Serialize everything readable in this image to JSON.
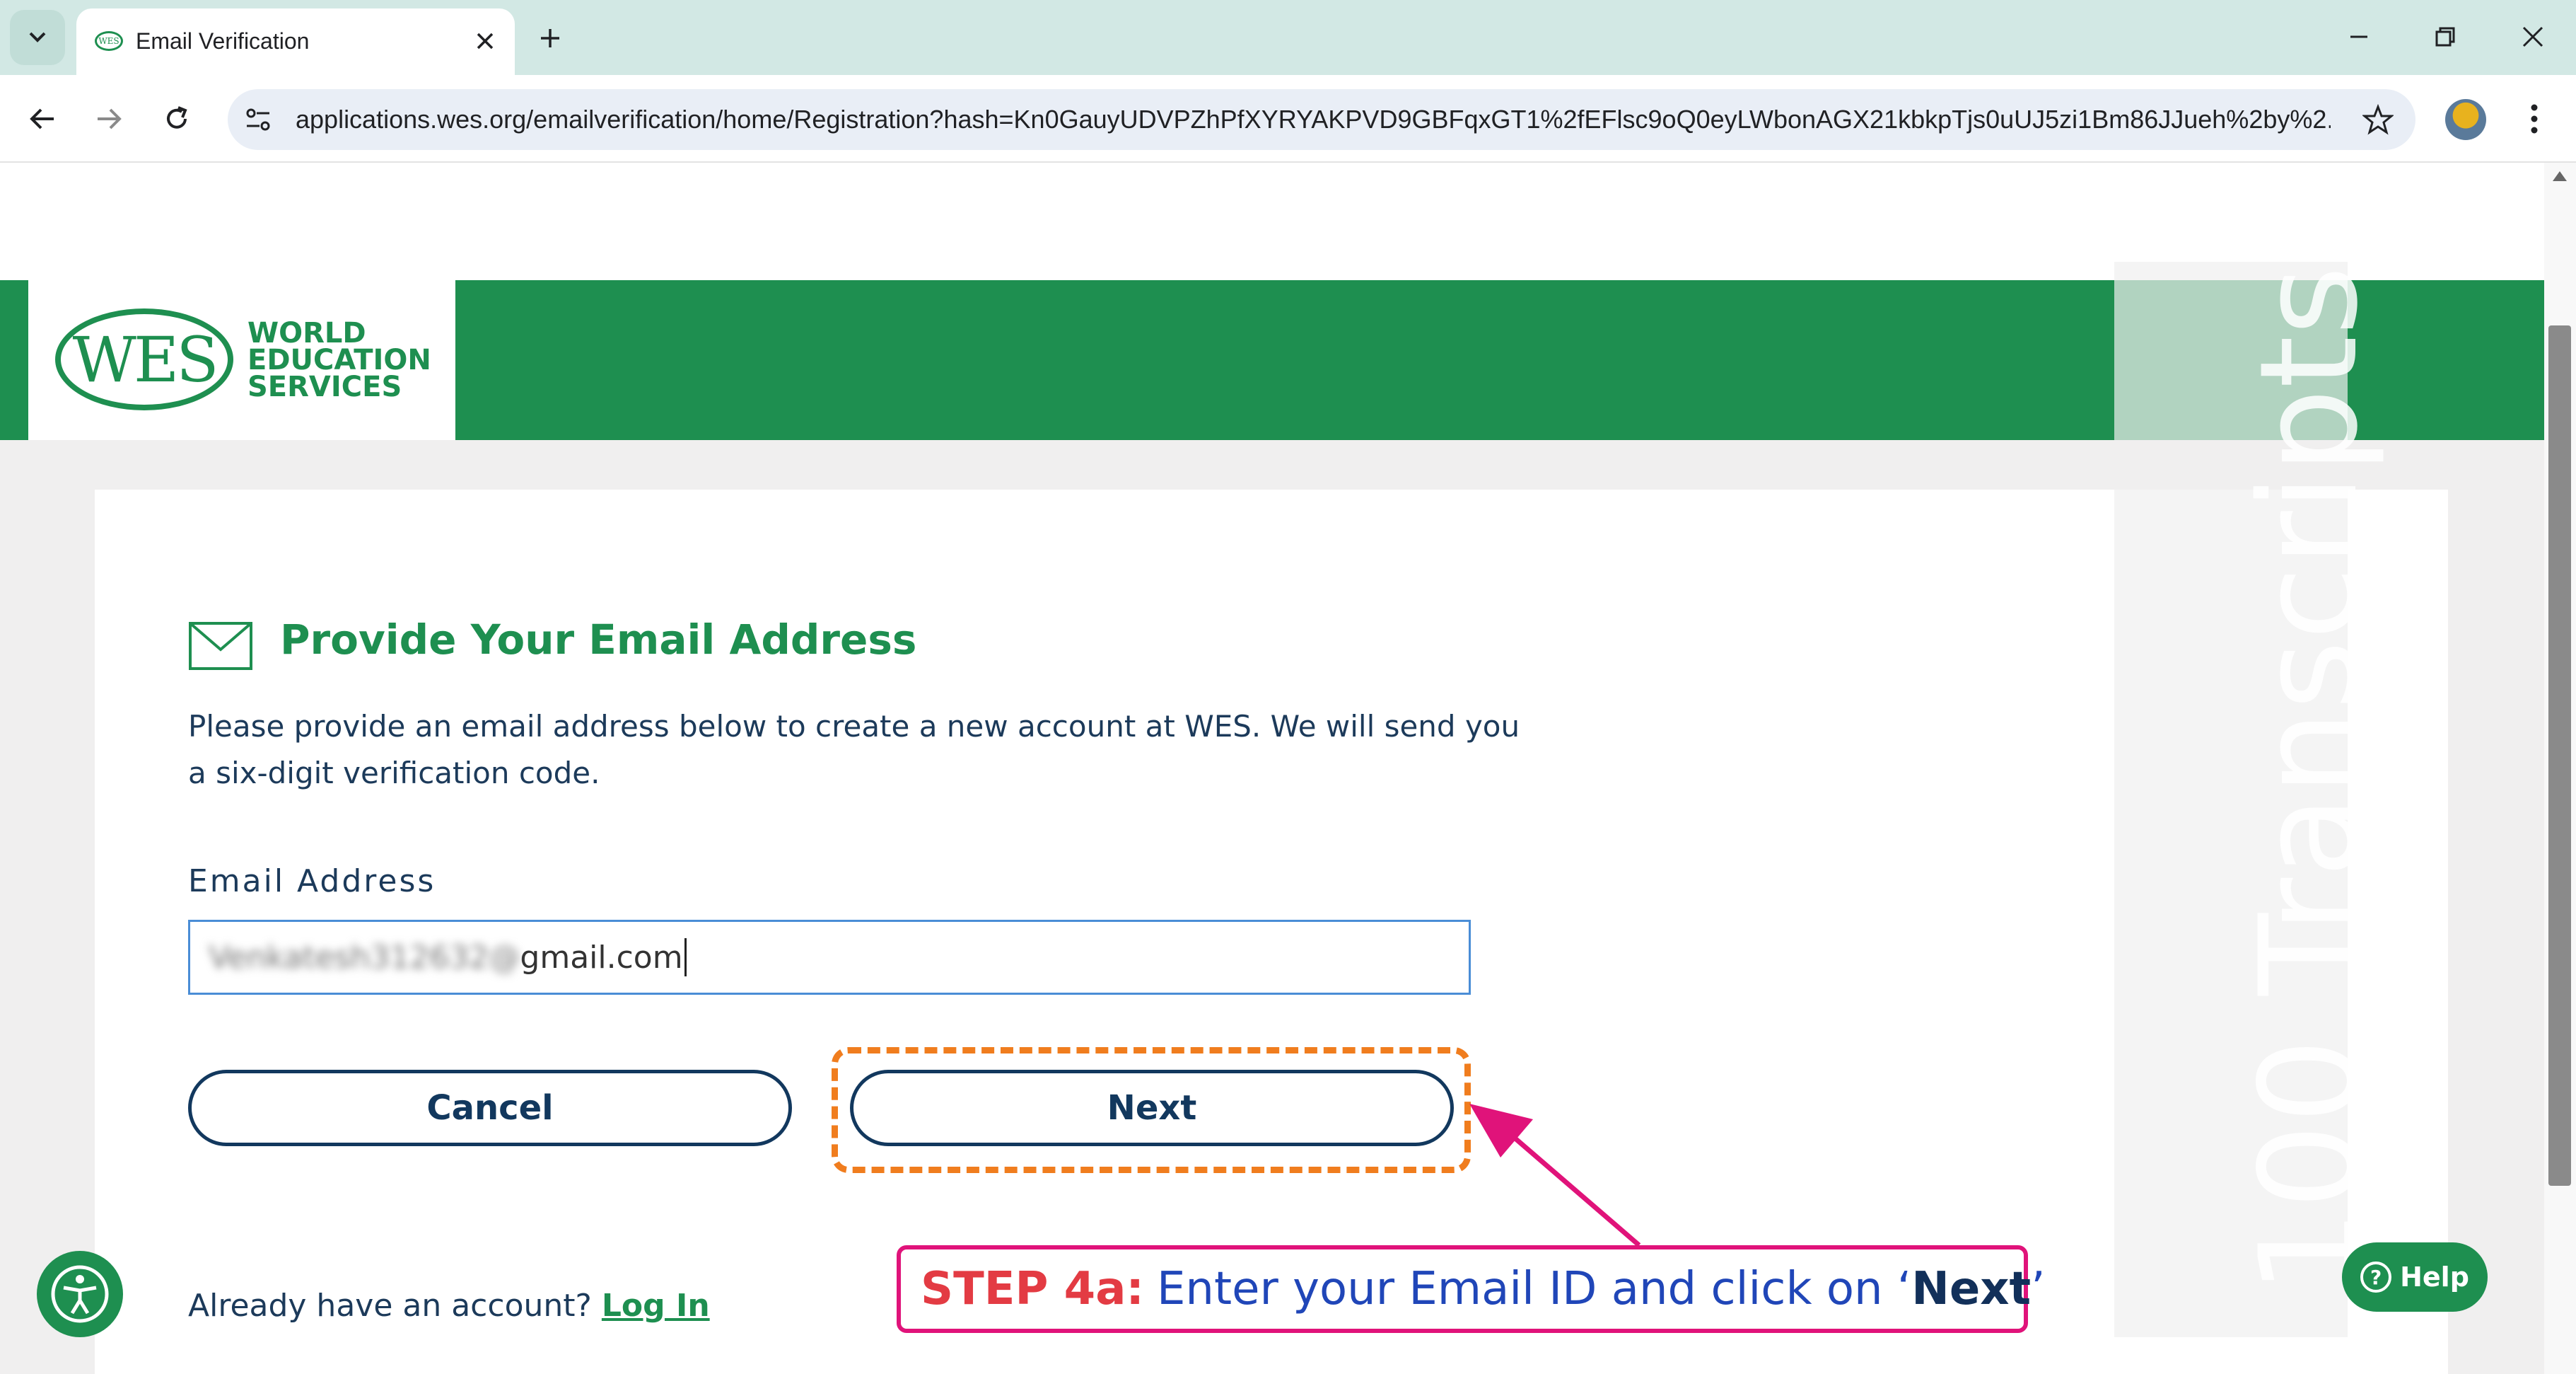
{
  "browser": {
    "tab_title": "Email Verification",
    "url": "applications.wes.org/emailverification/home/Registration?hash=Kn0GauyUDVPZhPfXYRYAKPVD9GBFqxGT1%2fEFlsc9oQ0eyLWbonAGX21kbkpTjs0uUJ5zi1Bm86JJueh%2by%2...",
    "icons": [
      "chevron-down-icon",
      "close-icon",
      "plus-icon",
      "minimize-icon",
      "restore-icon",
      "back-arrow-icon",
      "forward-arrow-icon",
      "reload-icon",
      "site-info-icon",
      "star-icon",
      "avatar",
      "kebab-menu-icon"
    ]
  },
  "header": {
    "logo_mark": "WES",
    "logo_lines": [
      "WORLD",
      "EDUCATION",
      "SERVICES"
    ],
    "brand_color": "#1e8f50"
  },
  "form": {
    "heading": "Provide Your Email Address",
    "description": "Please provide an email address below to create a new account at WES. We will send you a six-digit verification code.",
    "email_label": "Email Address",
    "email_value_blurred": "Venkatesh312632@",
    "email_value_domain": "gmail.com",
    "cancel_label": "Cancel",
    "next_label": "Next",
    "login_prompt": "Already have an account?",
    "login_link": "Log In"
  },
  "annotation": {
    "step": "STEP 4a:",
    "text": "Enter your Email ID and click on ‘",
    "emphasis": "Next",
    "close_quote": "’",
    "color": "#e0137a",
    "highlight_color": "#f07d1e"
  },
  "watermark": {
    "text": "100 Transcripts"
  },
  "widgets": {
    "help_label": "Help"
  }
}
